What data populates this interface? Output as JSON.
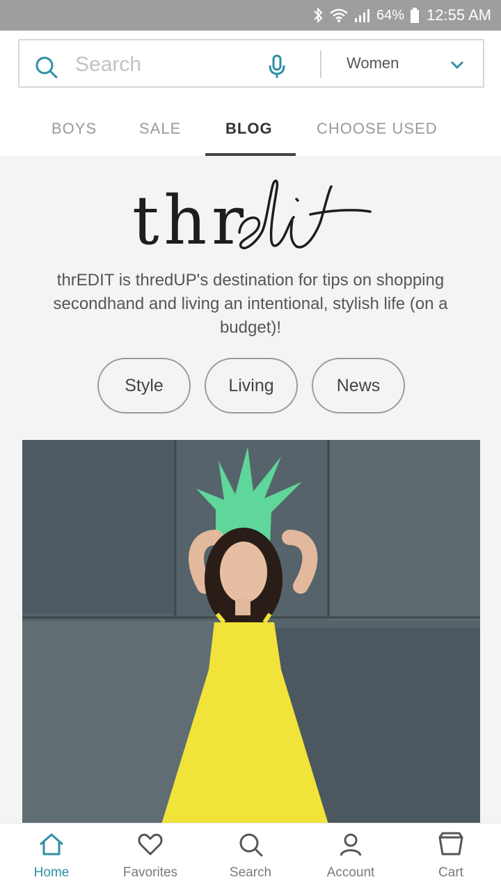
{
  "status_bar": {
    "battery": "64%",
    "time": "12:55 AM"
  },
  "search": {
    "placeholder": "Search",
    "department": "Women"
  },
  "tabs": [
    {
      "label": "BOYS"
    },
    {
      "label": "SALE"
    },
    {
      "label": "BLOG"
    },
    {
      "label": "CHOOSE USED"
    }
  ],
  "blog": {
    "logo_text": "thredit",
    "tagline": "thrEDIT is thredUP's destination for tips on shopping secondhand and living an intentional, stylish life (on a budget)!",
    "categories": [
      {
        "label": "Style"
      },
      {
        "label": "Living"
      },
      {
        "label": "News"
      }
    ]
  },
  "bottom_nav": [
    {
      "label": "Home",
      "icon": "home-icon"
    },
    {
      "label": "Favorites",
      "icon": "heart-icon"
    },
    {
      "label": "Search",
      "icon": "search-icon"
    },
    {
      "label": "Account",
      "icon": "account-icon"
    },
    {
      "label": "Cart",
      "icon": "cart-icon"
    }
  ],
  "colors": {
    "accent": "#2d8fa5",
    "status_bar": "#9e9e9e",
    "dress": "#f1e33a",
    "hat": "#5fd69a"
  }
}
